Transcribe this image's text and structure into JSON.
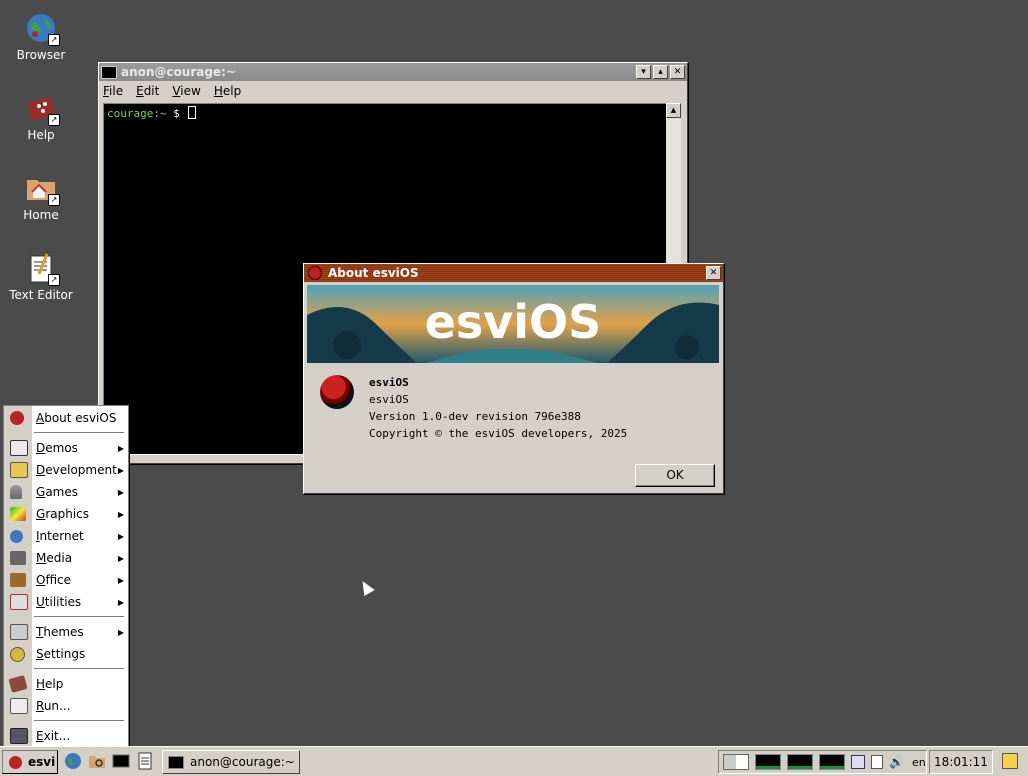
{
  "desktop": {
    "icons": [
      {
        "label": "Browser",
        "icon": "globe-icon"
      },
      {
        "label": "Help",
        "icon": "help-book-icon"
      },
      {
        "label": "Home",
        "icon": "home-folder-icon"
      },
      {
        "label": "Text Editor",
        "icon": "text-editor-icon"
      }
    ]
  },
  "terminal": {
    "title": "anon@courage:~",
    "menu": [
      "File",
      "Edit",
      "View",
      "Help"
    ],
    "prompt_host": "courage:~",
    "prompt_symbol": " $ "
  },
  "about": {
    "title": "About esviOS",
    "banner_text": "esviOS",
    "name": "esviOS",
    "subtitle": "esviOS",
    "version": "Version 1.0-dev revision 796e388",
    "copyright": "Copyright © the esviOS developers, 2025",
    "ok_label": "OK"
  },
  "start_menu": {
    "items": [
      {
        "label": "About esviOS",
        "submenu": false
      },
      {
        "label": "Demos",
        "submenu": true
      },
      {
        "label": "Development",
        "submenu": true
      },
      {
        "label": "Games",
        "submenu": true
      },
      {
        "label": "Graphics",
        "submenu": true
      },
      {
        "label": "Internet",
        "submenu": true
      },
      {
        "label": "Media",
        "submenu": true
      },
      {
        "label": "Office",
        "submenu": true
      },
      {
        "label": "Utilities",
        "submenu": true
      },
      {
        "label": "Themes",
        "submenu": true
      },
      {
        "label": "Settings",
        "submenu": false
      },
      {
        "label": "Help",
        "submenu": false
      },
      {
        "label": "Run...",
        "submenu": false
      },
      {
        "label": "Exit...",
        "submenu": false
      }
    ]
  },
  "taskbar": {
    "start_label": "esvi",
    "task_label": "anon@courage:~",
    "keyboard_layout": "en",
    "clock": "18:01:11"
  },
  "colors": {
    "desktop_bg": "#4b4b4b",
    "active_title": "#8a3410",
    "prompt": "#7fd43b"
  }
}
